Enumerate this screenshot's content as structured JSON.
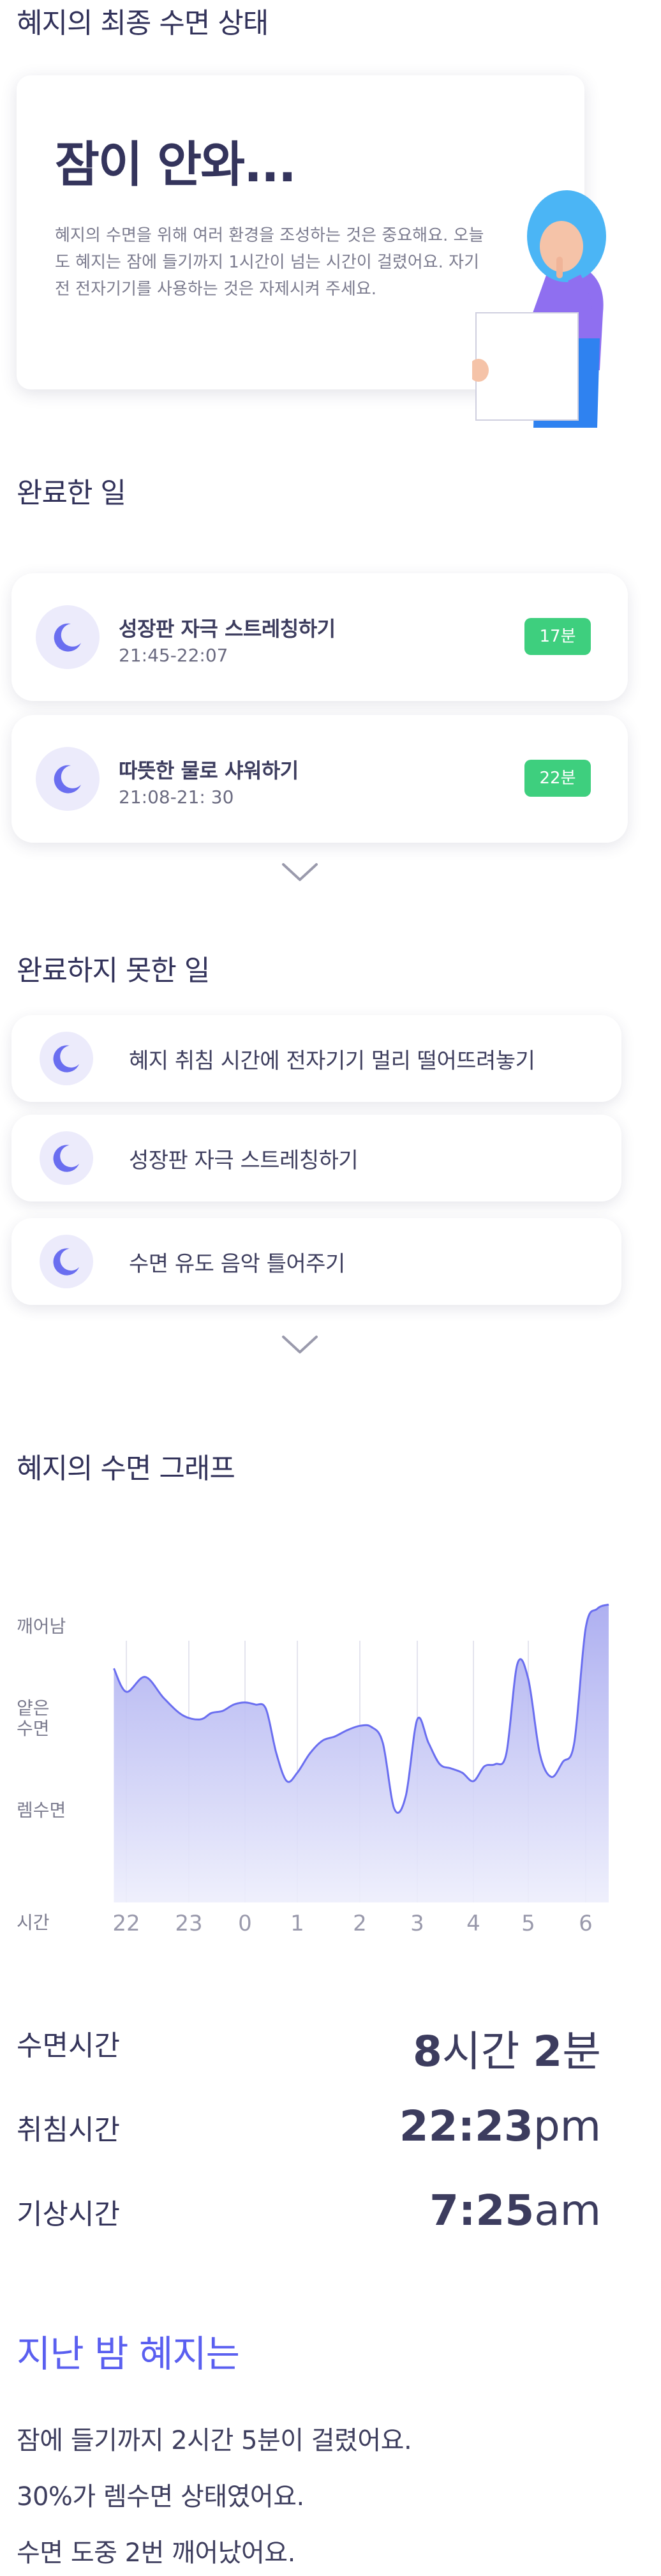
{
  "hero": {
    "section_title": "혜지의 최종 수면 상태",
    "headline": "잠이 안와...",
    "body": "혜지의 수면을 위해 여러 환경을 조성하는 것은 중요해요. 오늘도 혜지는 잠에 들기까지 1시간이 넘는 시간이 걸렸어요. 자기 전  전자기기를 사용하는 것은 자제시켜 주세요."
  },
  "completed": {
    "section_title": "완료한 일",
    "items": [
      {
        "title": "성장판 자극 스트레칭하기",
        "time": "21:45-22:07",
        "duration": "17분"
      },
      {
        "title": "따뜻한 물로 샤워하기",
        "time": "21:08-21: 30",
        "duration": "22분"
      }
    ]
  },
  "pending": {
    "section_title": "완료하지 못한 일",
    "items": [
      {
        "label": "혜지 취침 시간에 전자기기 멀리 떨어뜨려놓기"
      },
      {
        "label": "성장판 자극 스트레칭하기"
      },
      {
        "label": "수면 유도 음악 틀어주기"
      }
    ]
  },
  "graph": {
    "section_title": "혜지의 수면 그래프"
  },
  "chart_data": {
    "type": "area",
    "title": "혜지의 수면 그래프",
    "xlabel": "시간",
    "categories": [
      "22",
      "23",
      "0",
      "1",
      "2",
      "3",
      "4",
      "5",
      "6"
    ],
    "y_levels": [
      "깨어남",
      "얕은 수면",
      "렘수면"
    ],
    "series": [
      {
        "x": [
          21.8,
          22.0,
          22.3,
          22.6,
          22.9,
          23.2,
          23.4,
          23.6,
          23.8,
          0.0,
          0.2,
          0.4,
          0.6,
          0.8,
          1.0,
          1.2,
          1.4,
          1.6,
          1.8,
          2.0,
          2.2,
          2.4,
          2.6,
          2.8,
          3.0,
          3.2,
          3.4,
          3.6,
          3.8,
          4.0,
          4.2,
          4.4,
          4.6,
          4.8,
          5.0,
          5.2,
          5.4,
          5.6,
          5.8,
          6.0,
          6.2,
          6.4
        ],
        "values": [
          1.0,
          0.78,
          0.92,
          0.72,
          0.56,
          0.52,
          0.58,
          0.6,
          0.66,
          0.68,
          0.66,
          0.62,
          0.2,
          -0.06,
          0.02,
          0.2,
          0.32,
          0.36,
          0.42,
          0.46,
          0.45,
          0.3,
          -0.32,
          -0.2,
          0.52,
          0.3,
          0.1,
          0.06,
          0.02,
          -0.06,
          0.08,
          0.1,
          0.2,
          1.04,
          0.9,
          0.2,
          -0.02,
          0.12,
          0.3,
          1.38,
          1.56,
          1.6
        ]
      }
    ],
    "ylim": [
      -1.2,
      1.8
    ],
    "grid": true,
    "colors": {
      "line": "#6a6ef0",
      "fill_top": "#a5a7ef",
      "fill_bottom": "#edeefc"
    }
  },
  "stats": [
    {
      "label": "수면시간",
      "num1": "8",
      "unit1": "시간 ",
      "num2": "2",
      "unit2": "분"
    },
    {
      "label": "취침시간",
      "num1": "22:23",
      "unit1": "pm",
      "num2": "",
      "unit2": ""
    },
    {
      "label": "기상시간",
      "num1": "7:25",
      "unit1": "am",
      "num2": "",
      "unit2": ""
    }
  ],
  "summary": {
    "title": "지난 밤 혜지는",
    "lines": [
      "잠에 들기까지 2시간 5분이 걸렸어요.",
      "30%가 렘수면 상태였어요.",
      "수면 도중 2번 깨어났어요."
    ]
  },
  "icons": {
    "moon": "moon-icon",
    "chevron": "chevron-down-icon"
  },
  "colors": {
    "accent": "#5a5ff0",
    "badge": "#3ecf7e",
    "moon": "#6a6ef0",
    "moon_bg": "#ecebfb"
  }
}
